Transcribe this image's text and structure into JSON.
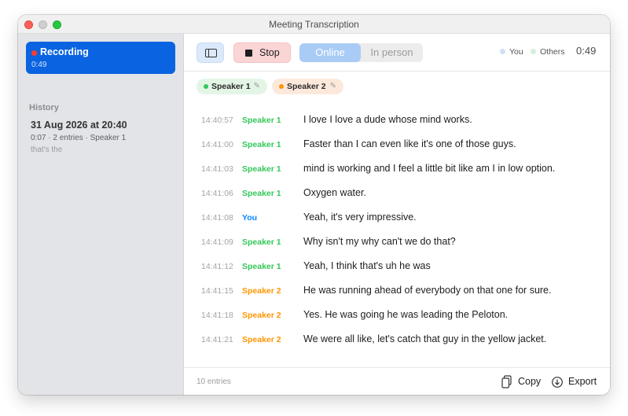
{
  "window": {
    "title": "Meeting Transcription"
  },
  "sidebar": {
    "current": {
      "label": "Recording",
      "time": "0:49"
    },
    "history_label": "History",
    "history": [
      {
        "title": "31 Aug 2026 at 20:40",
        "meta": "0:07 · 2 entries · Speaker 1",
        "preview": "that's the"
      }
    ]
  },
  "toolbar": {
    "stop_label": "Stop",
    "mode_options": [
      "Online",
      "In person"
    ],
    "mode_selected": "Online",
    "legend": {
      "you": "You",
      "others": "Others"
    },
    "elapsed": "0:49"
  },
  "speakers": [
    {
      "name": "Speaker 1",
      "color": "#34c759"
    },
    {
      "name": "Speaker 2",
      "color": "#ff9500"
    }
  ],
  "colors": {
    "you": "#0a84ff",
    "speaker_1": "#34c759",
    "speaker_2": "#ff9500",
    "accent": "#0a63e0"
  },
  "transcript": [
    {
      "time": "14:40:57",
      "speaker": "Speaker 1",
      "text": "I love I love a dude whose mind works."
    },
    {
      "time": "14:41:00",
      "speaker": "Speaker 1",
      "text": "Faster than I can even like it's one of those guys."
    },
    {
      "time": "14:41:03",
      "speaker": "Speaker 1",
      "text": "mind is working and I feel a little bit like am I in low option."
    },
    {
      "time": "14:41:06",
      "speaker": "Speaker 1",
      "text": "Oxygen water."
    },
    {
      "time": "14:41:08",
      "speaker": "You",
      "text": "Yeah, it's very impressive."
    },
    {
      "time": "14:41:09",
      "speaker": "Speaker 1",
      "text": "Why isn't my why can't we do that?"
    },
    {
      "time": "14:41:12",
      "speaker": "Speaker 1",
      "text": "Yeah, I think that's uh he was"
    },
    {
      "time": "14:41:15",
      "speaker": "Speaker 2",
      "text": "He was running ahead of everybody on that one for sure."
    },
    {
      "time": "14:41:18",
      "speaker": "Speaker 2",
      "text": "Yes. He was going he was leading the Peloton."
    },
    {
      "time": "14:41:21",
      "speaker": "Speaker 2",
      "text": "We were all like, let's catch that guy in the yellow jacket."
    }
  ],
  "footer": {
    "entries": "10 entries",
    "copy_label": "Copy",
    "export_label": "Export"
  }
}
